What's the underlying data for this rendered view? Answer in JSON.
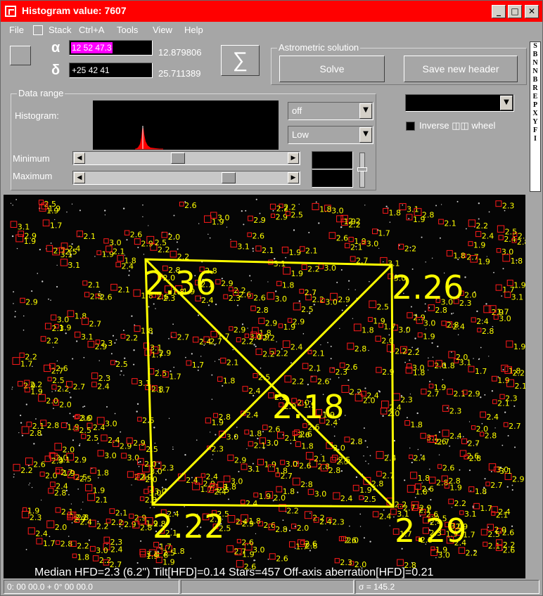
{
  "window": {
    "title": "Histogram value: 7607",
    "btn_minimize": "_",
    "btn_maximize": "□",
    "btn_close": "✕"
  },
  "menu": [
    "File",
    "Stack",
    "Ctrl+A",
    "Tools",
    "View",
    "Help"
  ],
  "coords": {
    "alpha_symbol": "α",
    "delta_symbol": "δ",
    "alpha_input": "12 52 47.3",
    "delta_input": "+25 42 41",
    "alpha_value": "12.879806",
    "delta_value": "25.711389",
    "sigma_button": "∑"
  },
  "astrometric": {
    "title": "Astrometric solution",
    "solve": "Solve",
    "save_header": "Save new header"
  },
  "data_range": {
    "title": "Data range",
    "histogram_label": "Histogram:",
    "minimum_label": "Minimum",
    "maximum_label": "Maximum",
    "combo1": "off",
    "combo2": "Low",
    "min_slider": 0.45,
    "max_slider": 0.72
  },
  "right_panel": {
    "inverse_label": "Inverse ◫◫ wheel",
    "strip_letters": [
      "S",
      "B",
      "N",
      "N",
      "B",
      "R",
      "E",
      "P",
      "X",
      "Y",
      "F",
      "I"
    ]
  },
  "overlay": {
    "tilt_labels": [
      "2.36",
      "2.26",
      "2.18",
      "2.22",
      "2.29"
    ],
    "summary": "Median HFD=2.3 (6.2\")  Tilt[HFD]=0.14  Stars=457  Off-axis aberration[HFD]=0.21"
  },
  "status": {
    "cell1": "0: 00  00.0  + 0° 00  00.0",
    "cell2": "",
    "cell3": "σ = 145.2"
  },
  "colors": {
    "title_bar": "#ff0000",
    "panel": "#a6a6a6",
    "star_box": "#ff1a1a",
    "label": "#ffff00",
    "alpha_highlight": "#ff00ff"
  }
}
